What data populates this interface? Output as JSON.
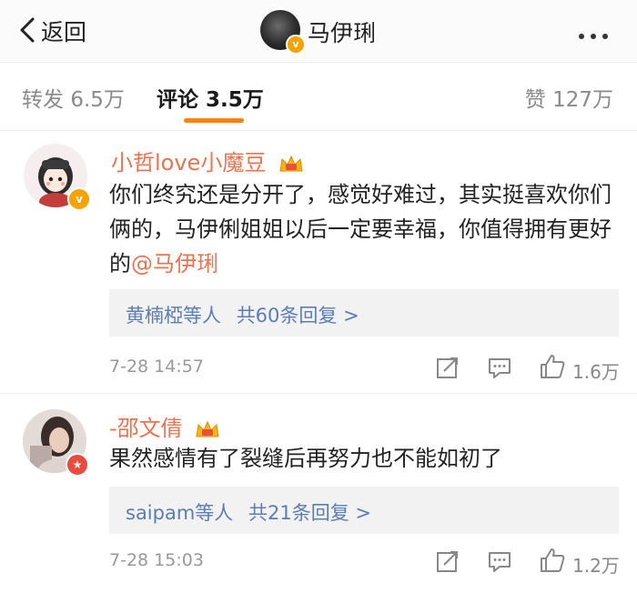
{
  "header": {
    "back_label": "返回",
    "title": "马伊琍",
    "more_icon": "more-dots-icon"
  },
  "tabs": [
    {
      "label": "转发",
      "count": "6.5万"
    },
    {
      "label": "评论",
      "count": "3.5万"
    },
    {
      "label": "赞",
      "count": "127万"
    }
  ],
  "colors": {
    "accent": "#ff8200",
    "username": "#eb7350",
    "link": "#5a7db8",
    "muted": "#999999"
  },
  "comments": [
    {
      "username": "小哲love小魔豆",
      "text": "你们终究还是分开了，感觉好难过，其实挺喜欢你们俩的，马伊俐姐姐以后一定要幸福，你值得拥有更好的",
      "mention": "@马伊琍",
      "reply_users": "黄楠椏等人",
      "reply_count": "共60条回复 >",
      "time": "7-28 14:57",
      "likes": "1.6万"
    },
    {
      "username": "-邵文倩",
      "text": "果然感情有了裂缝后再努力也不能如初了",
      "mention": "",
      "reply_users": "saipam等人",
      "reply_count": "共21条回复 >",
      "time": "7-28 15:03",
      "likes": "1.2万"
    }
  ]
}
